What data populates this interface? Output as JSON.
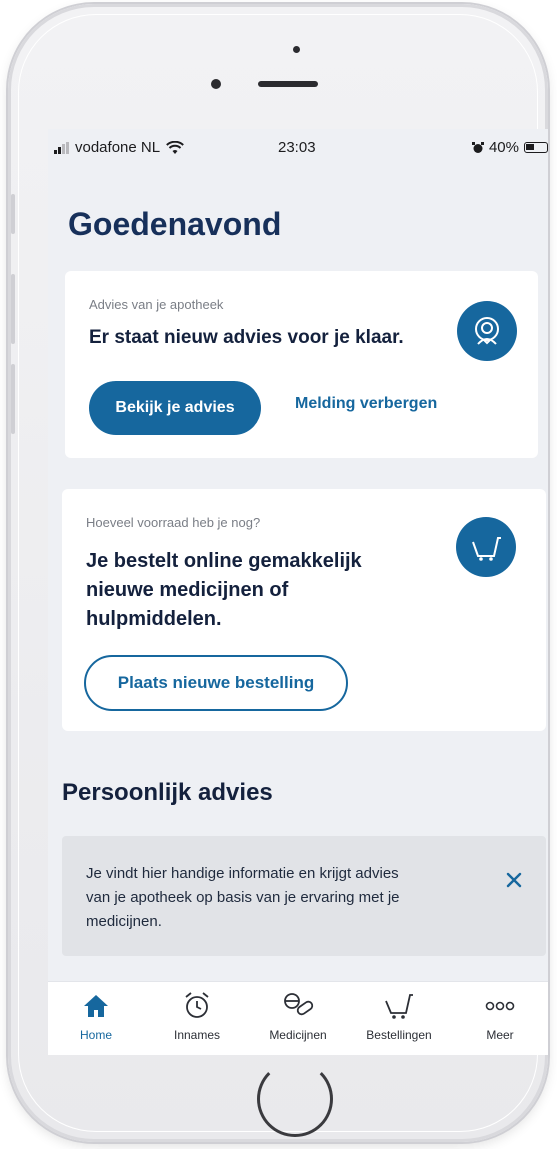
{
  "status_bar": {
    "carrier": "vodafone NL",
    "time": "23:03",
    "battery": "40%"
  },
  "greeting": "Goedenavond",
  "advice_card": {
    "label": "Advies van je apotheek",
    "title": "Er staat nieuw advies voor je klaar.",
    "primary_button": "Bekijk je advies",
    "secondary_link": "Melding verbergen",
    "icon": "pharmacist-icon"
  },
  "order_card": {
    "label": "Hoeveel voorraad heb je nog?",
    "title_line1": "Je bestelt online gemakkelijk",
    "title_line2": "nieuwe medicijnen of",
    "title_line3": "hulpmiddelen.",
    "button": "Plaats nieuwe bestelling",
    "icon": "cart-icon"
  },
  "personal_advice": {
    "heading": "Persoonlijk advies",
    "info_line1": "Je vindt hier handige informatie en krijgt advies",
    "info_line2": "van je apotheek op basis van je ervaring met je",
    "info_line3": "medicijnen."
  },
  "tabbar": {
    "items": [
      {
        "label": "Home",
        "icon": "home-icon",
        "active": true
      },
      {
        "label": "Innames",
        "icon": "alarm-clock-icon",
        "active": false
      },
      {
        "label": "Medicijnen",
        "icon": "pills-icon",
        "active": false
      },
      {
        "label": "Bestellingen",
        "icon": "cart-icon",
        "active": false
      },
      {
        "label": "Meer",
        "icon": "more-icon",
        "active": false
      }
    ]
  },
  "colors": {
    "primary": "#16679e",
    "heading": "#17305a",
    "background": "#eef0f4"
  }
}
